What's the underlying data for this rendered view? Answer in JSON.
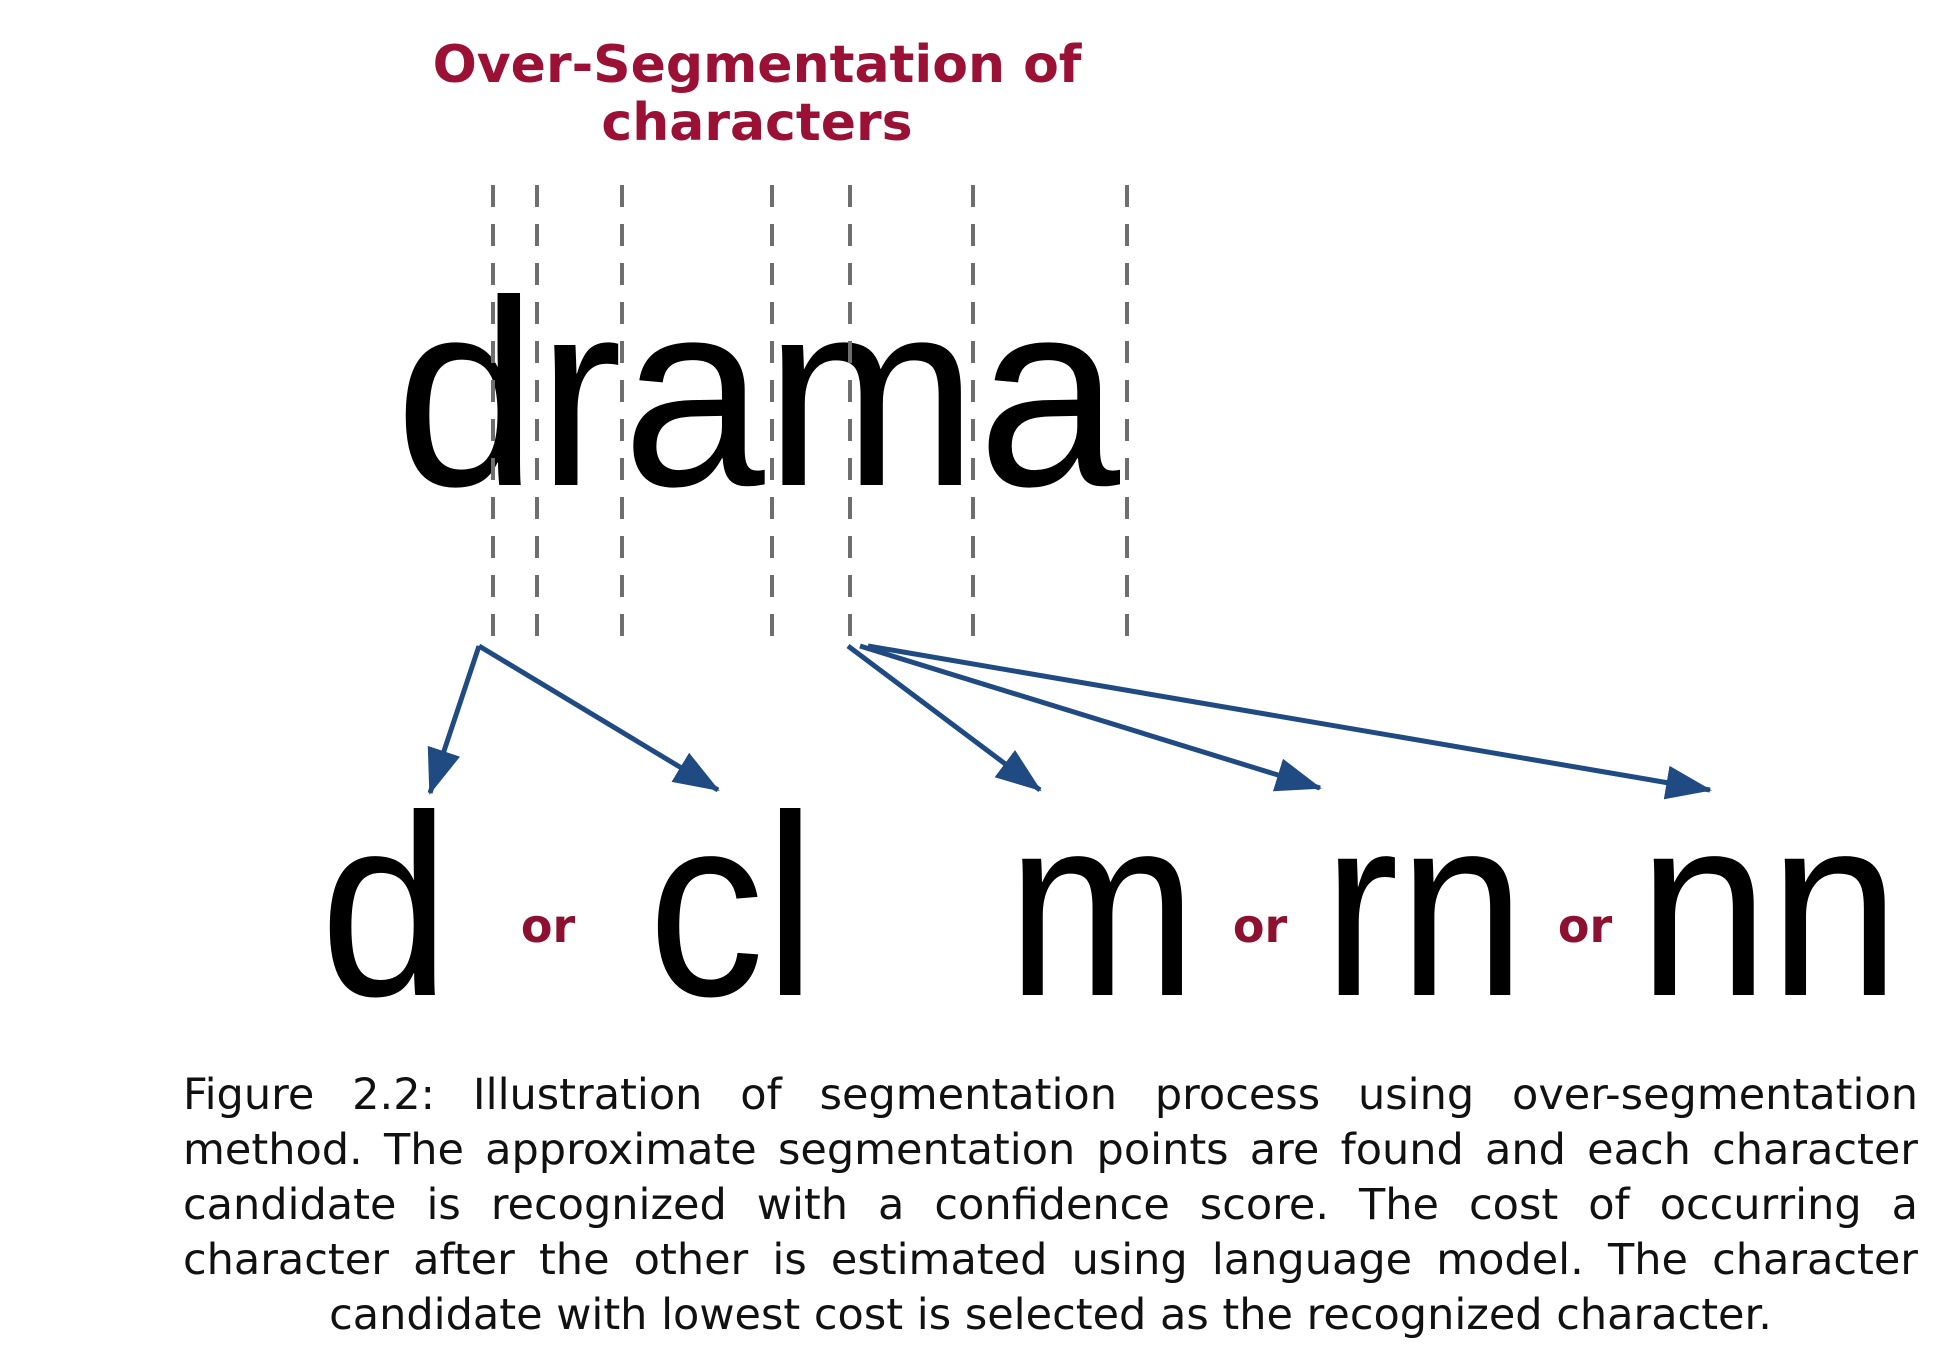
{
  "title_lines": [
    "Over-Segmentation of",
    "characters"
  ],
  "word": "drama",
  "candidate_groups": [
    {
      "options": [
        "d",
        "cl"
      ]
    },
    {
      "options": [
        "m",
        "rn",
        "nn"
      ]
    }
  ],
  "or_label": "or",
  "caption": "Figure 2.2: Illustration of segmentation process using over-segmentation method. The approximate segmentation points are found and each character candidate is rec­ognized with a confidence score. The cost of occurring a character after the other is estimated using language model.  The character candidate with lowest cost is se­lected as the recognized character.",
  "colors": {
    "title": "#9b1035",
    "or_label": "#8c1030",
    "arrow": "#204a82",
    "segment_line": "#6e6e6e",
    "text": "#000000"
  }
}
